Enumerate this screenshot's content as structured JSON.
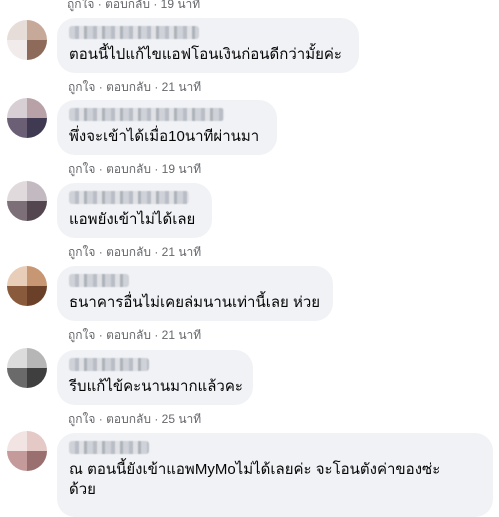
{
  "labels": {
    "like": "ถูกใจ",
    "reply": "ตอบกลับ",
    "sep": "·"
  },
  "top_partial_time": "19 นาที",
  "comments": [
    {
      "text": "ตอนนี้ไปแก้ไขแอฟโอนเงินก่อนดีกว่ามั้ยค่ะ",
      "time": "21 นาที",
      "avatar_colors": [
        "#8d6a5a",
        "#c7a99a",
        "#5e4a48",
        "#e6dcd8"
      ]
    },
    {
      "text": "พึ่งจะเข้าได้เมื่อ10นาทีผ่านมา",
      "time": "19 นาที",
      "avatar_colors": [
        "#6b5f76",
        "#b8a2a8",
        "#3f3a52",
        "#d8cfd4"
      ]
    },
    {
      "text": "แอพยังเข้าไม่ได้เลย",
      "time": "21 นาที",
      "avatar_colors": [
        "#7c6f78",
        "#c3b9c0",
        "#54464f",
        "#e1dadd"
      ]
    },
    {
      "text": "ธนาคารอื่นไม่เคยล่มนานเท่านี้เลย ห่วย",
      "time": "21 นาที",
      "avatar_colors": [
        "#8a5a3d",
        "#c79672",
        "#6a4128",
        "#e8cdb8"
      ]
    },
    {
      "text": "รีบแก้ไข้คะนานมากแล้วคะ",
      "time": "25 นาที",
      "avatar_colors": [
        "#6a6a6a",
        "#b6b6b6",
        "#3f3f3f",
        "#dcdcdc"
      ]
    },
    {
      "text_line1": "ณ ตอนนี้ยังเข้าแอพMyMoไม่ได้เลยค่ะ จะโอนตังค่าของซ่ะ",
      "text_line2": "ด้วย",
      "avatar_colors": [
        "#c49a9a",
        "#e4c9c6",
        "#9a6f70",
        "#f1e4e2"
      ]
    }
  ]
}
